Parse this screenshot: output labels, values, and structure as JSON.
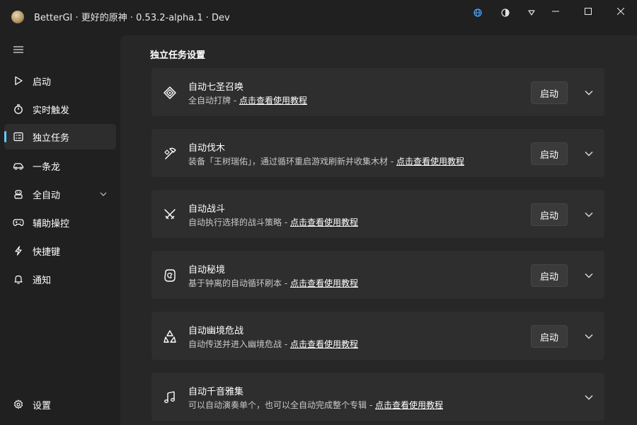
{
  "titlebar": {
    "title": "BetterGI · 更好的原神 · 0.53.2-alpha.1 · Dev",
    "icons": [
      "app-icon",
      "globe-icon",
      "theme-icon",
      "dropdown-icon",
      "minimize-icon",
      "maximize-icon",
      "close-icon"
    ]
  },
  "sidebar": {
    "items": [
      {
        "label": "启动",
        "icon": "play-icon"
      },
      {
        "label": "实时触发",
        "icon": "timer-icon"
      },
      {
        "label": "独立任务",
        "icon": "task-list-icon",
        "active": true
      },
      {
        "label": "一条龙",
        "icon": "car-icon"
      },
      {
        "label": "全自动",
        "icon": "robot-icon",
        "expandable": true
      },
      {
        "label": "辅助操控",
        "icon": "gamepad-icon"
      },
      {
        "label": "快捷键",
        "icon": "flash-icon"
      },
      {
        "label": "通知",
        "icon": "bell-icon"
      }
    ],
    "settings_label": "设置"
  },
  "main": {
    "section_title": "独立任务设置",
    "tasks": [
      {
        "title": "自动七圣召唤",
        "desc": "全自动打牌 - ",
        "link": "点击查看使用教程",
        "button": "启动",
        "icon": "card-game-icon"
      },
      {
        "title": "自动伐木",
        "desc": "装备「王树瑞佑」，通过循环重启游戏刷新并收集木材 - ",
        "link": "点击查看使用教程",
        "button": "启动",
        "icon": "axe-icon"
      },
      {
        "title": "自动战斗",
        "desc": "自动执行选择的战斗策略 - ",
        "link": "点击查看使用教程",
        "button": "启动",
        "icon": "swords-icon"
      },
      {
        "title": "自动秘境",
        "desc": "基于钟离的自动循环刷本 - ",
        "link": "点击查看使用教程",
        "button": "启动",
        "icon": "domain-icon"
      },
      {
        "title": "自动幽境危战",
        "desc": "自动传送并进入幽境危战 - ",
        "link": "点击查看使用教程",
        "button": "启动",
        "icon": "recycle-icon"
      },
      {
        "title": "自动千音雅集",
        "desc": "可以自动演奏单个，也可以全自动完成整个专辑 - ",
        "link": "点击查看使用教程",
        "icon": "music-icon"
      }
    ]
  },
  "colors": {
    "background": "#202020",
    "content": "#272727",
    "card": "#2e2e2e",
    "accent": "#60cdff"
  }
}
